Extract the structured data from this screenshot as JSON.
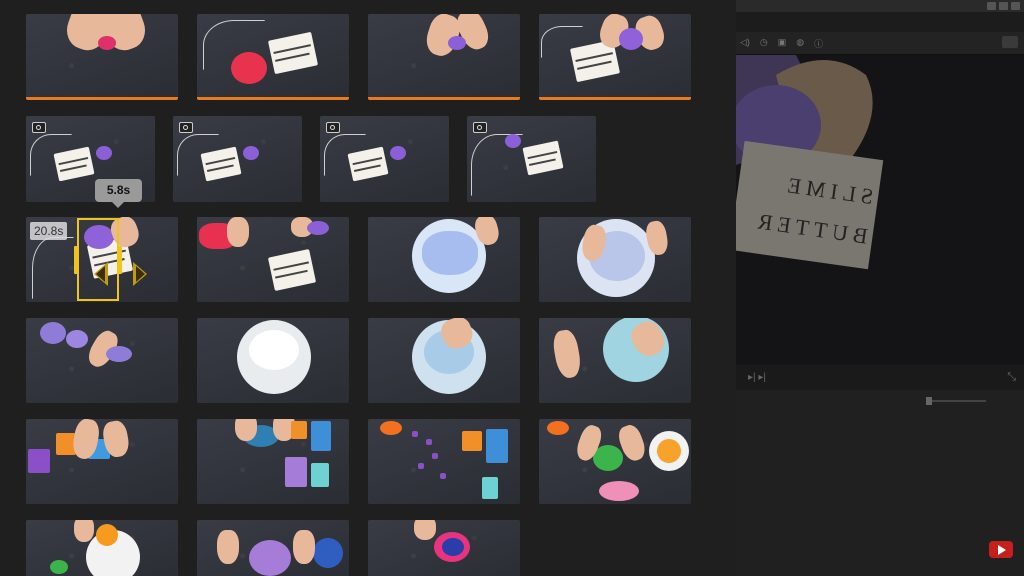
{
  "browser": {
    "range_tooltip": "5.8s",
    "clip_duration": "20.8s"
  },
  "card_text": [
    "BUTTER",
    "SLIME"
  ],
  "colors": {
    "used_marker": "#e87b1e",
    "selection": "#f0c419",
    "youtube": "#c6201d"
  }
}
